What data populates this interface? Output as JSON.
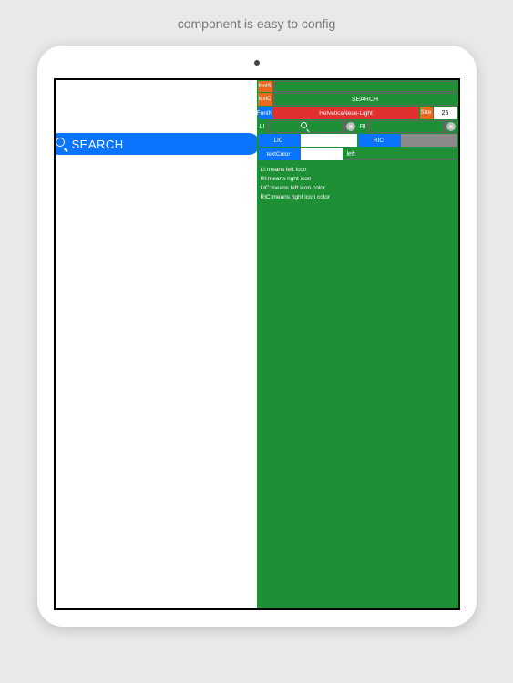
{
  "caption": "component is easy to config",
  "searchPill": {
    "label": "SEARCH"
  },
  "config": {
    "row1": {
      "label": "fontS",
      "value": ""
    },
    "row2": {
      "label": "textC",
      "value": "SEARCH"
    },
    "row3": {
      "label": "FontN",
      "value": "HelveticaNeue-Light",
      "sizeLabel": "Size",
      "sizeValue": "25"
    },
    "row4": {
      "liLabel": "LI",
      "riLabel": "RI"
    },
    "row5": {
      "licLabel": "LIC",
      "ricLabel": "RIC"
    },
    "row6": {
      "textColorLabel": "textColor",
      "alignValue": "left"
    },
    "legend": {
      "l1": "LI:means left icon",
      "l2": "RI:means right icon",
      "l3": "LIC:means left icon color",
      "l4": "RIC:means right icon color"
    }
  }
}
